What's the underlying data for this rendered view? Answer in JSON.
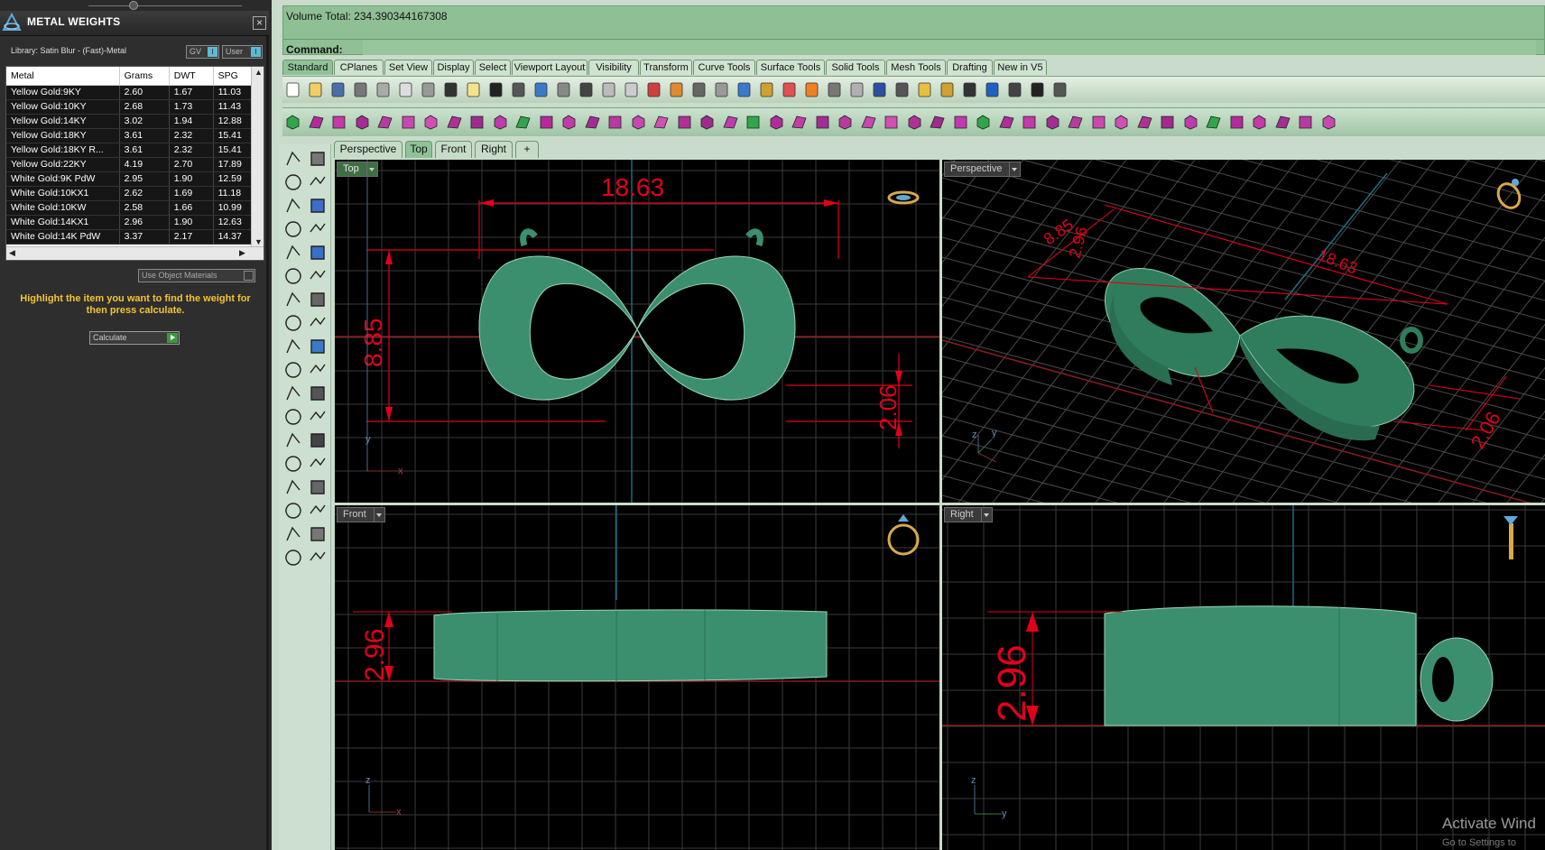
{
  "panel": {
    "title": "METAL WEIGHTS",
    "library": "Library: Satin Blur - (Fast)-Metal",
    "toggle_gv": "GV",
    "toggle_user": "User",
    "toggle_knob": "I",
    "columns": [
      "Metal",
      "Grams",
      "DWT",
      "SPG"
    ],
    "rows": [
      [
        "Yellow Gold:9KY",
        "2.60",
        "1.67",
        "11.03"
      ],
      [
        "Yellow Gold:10KY",
        "2.68",
        "1.73",
        "11.43"
      ],
      [
        "Yellow Gold:14KY",
        "3.02",
        "1.94",
        "12.88"
      ],
      [
        "Yellow Gold:18KY",
        "3.61",
        "2.32",
        "15.41"
      ],
      [
        "Yellow Gold:18KY R...",
        "3.61",
        "2.32",
        "15.41"
      ],
      [
        "Yellow Gold:22KY",
        "4.19",
        "2.70",
        "17.89"
      ],
      [
        "White Gold:9K PdW",
        "2.95",
        "1.90",
        "12.59"
      ],
      [
        "White Gold:10KX1",
        "2.62",
        "1.69",
        "11.18"
      ],
      [
        "White Gold:10KW",
        "2.58",
        "1.66",
        "10.99"
      ],
      [
        "White Gold:14KX1",
        "2.96",
        "1.90",
        "12.63"
      ],
      [
        "White Gold:14K PdW",
        "3.37",
        "2.17",
        "14.37"
      ]
    ],
    "use_object_materials": "Use Object Materials",
    "instruction": "Highlight the item you want to find the weight for then press calculate.",
    "calculate": "Calculate"
  },
  "command": {
    "volume": "Volume Total: 234.390344167308",
    "label": "Command:",
    "value": ""
  },
  "toolbar_tabs": [
    "Standard",
    "CPlanes",
    "Set View",
    "Display",
    "Select",
    "Viewport Layout",
    "Visibility",
    "Transform",
    "Curve Tools",
    "Surface Tools",
    "Solid Tools",
    "Mesh Tools",
    "Drafting",
    "New in V5"
  ],
  "viewport_tabs": [
    "Perspective",
    "Top",
    "Front",
    "Right",
    "+"
  ],
  "viewports": {
    "top": {
      "label": "Top",
      "dim_width": "18.63",
      "dim_height": "8.85",
      "dim_thick": "2.06"
    },
    "perspective": {
      "label": "Perspective",
      "dim_a": "8.85",
      "dim_b": "2.96",
      "dim_c": "18.63",
      "dim_d": "2.06"
    },
    "front": {
      "label": "Front",
      "dim_height": "2.96"
    },
    "right": {
      "label": "Right",
      "dim_height": "2.96"
    }
  },
  "axes": {
    "x": "x",
    "y": "y",
    "z": "z"
  },
  "watermark": {
    "line1": "Activate Wind",
    "line2": "Go to Settings to"
  },
  "colors": {
    "model": "#3a8f6e",
    "dimension": "#e0001b",
    "accent_green": "#8fc397"
  }
}
